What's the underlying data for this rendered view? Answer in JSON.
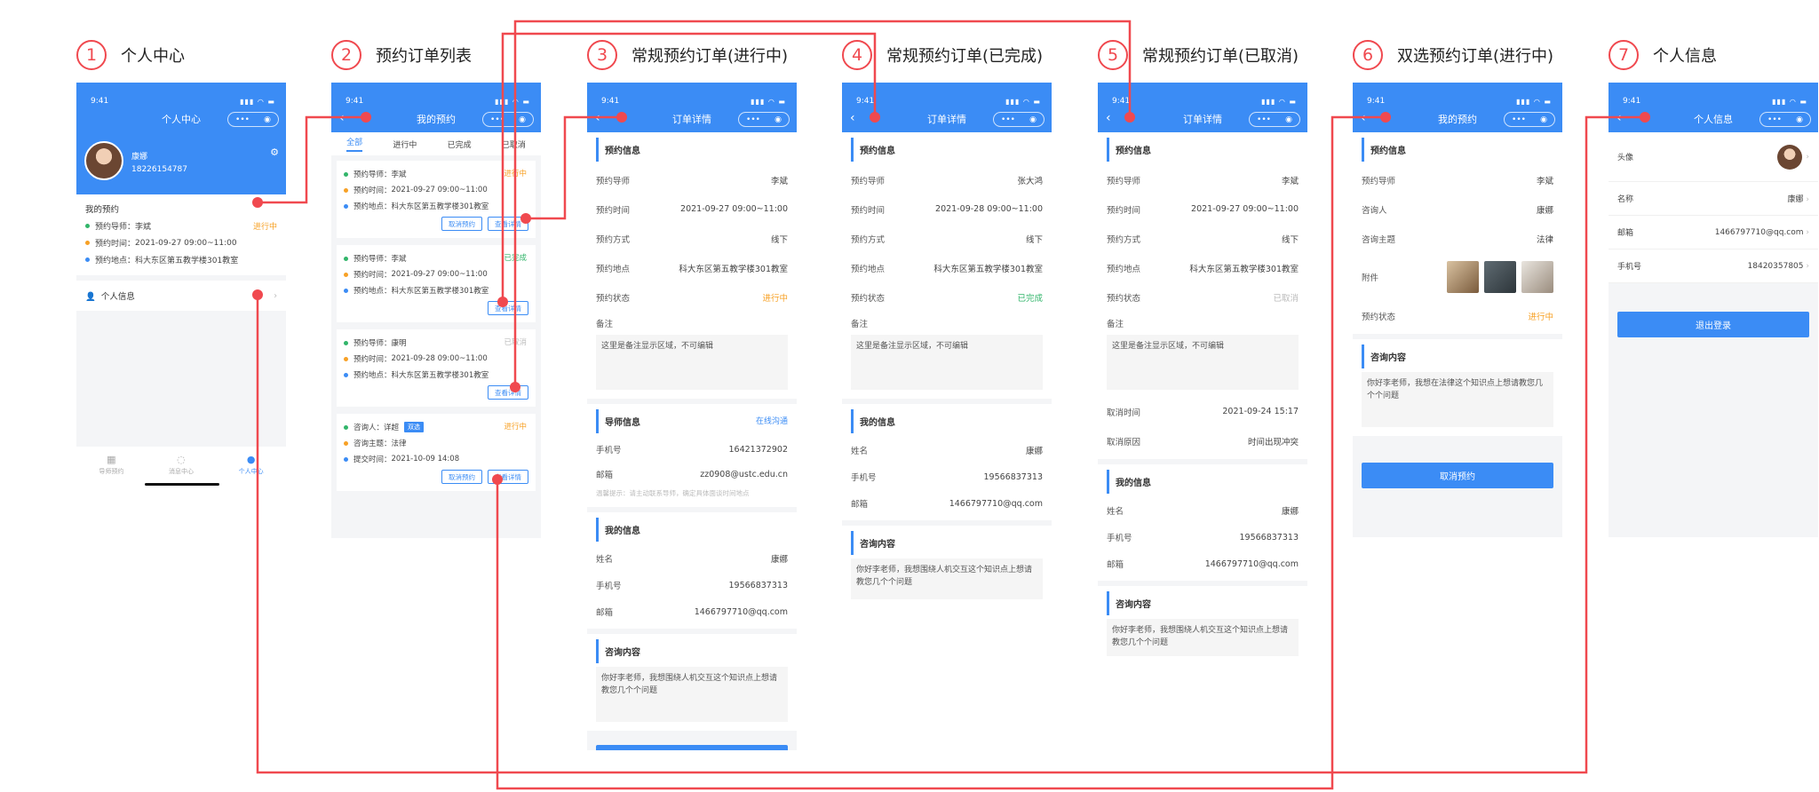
{
  "status_time": "9:41",
  "labels": {
    "mentor": "预约导师",
    "time": "预约时间",
    "method": "预约方式",
    "location": "预约地点",
    "state": "预约状态",
    "remark": "备注",
    "phone": "手机号",
    "email": "邮箱",
    "name": "姓名",
    "consultant": "咨询人",
    "topic": "咨询主题",
    "attachment": "附件",
    "cancel_time": "取消时间",
    "cancel_reason": "取消原因",
    "sec_appointment": "预约信息",
    "sec_mentor": "导师信息",
    "sec_my": "我的信息",
    "sec_content": "咨询内容",
    "online_chat": "在线沟通",
    "cancel_btn": "取消预约",
    "view_btn": "查看详情",
    "mentor_hint": "温馨提示：请主动联系导师，确定具体面谈时间地点",
    "pre_mentor": "预约导师：",
    "pre_time": "预约时间：",
    "pre_location": "预约地点：",
    "pre_consultant": "咨询人：",
    "pre_topic": "咨询主题：",
    "pre_submit": "提交时间："
  },
  "values": {
    "mentor_li": "李斌",
    "mentor_zhang": "张大鸿",
    "mentor_kang": "康明",
    "time_27": "2021-09-27 09:00~11:00",
    "time_28": "2021-09-28 09:00~11:00",
    "method": "线下",
    "location": "科大东区第五教学楼301教室",
    "status_ongoing": "进行中",
    "status_done": "已完成",
    "status_cancelled": "已取消",
    "remark_text": "这里是备注显示区域，不可编辑",
    "mentor_phone": "16421372902",
    "mentor_email": "zz0908@ustc.edu.cn",
    "my_name": "康娜",
    "my_phone": "19566837313",
    "my_email": "1466797710@qq.com",
    "consult_text": "你好李老师，我想围绕人机交互这个知识点上想请教您几个个问题",
    "consult_text_6": "你好李老师，我想在法律这个知识点上想请教您几个个问题",
    "cancel_time": "2021-09-24 15:17",
    "cancel_reason": "时间出现冲突",
    "consultant_name": "详超",
    "dual_badge": "双选",
    "topic_law": "法律",
    "submit_time": "2021-10-09 14:08"
  },
  "screens": [
    {
      "num": "1",
      "title": "个人中心",
      "nav_title": "个人中心",
      "user_name": "康娜",
      "user_phone": "18226154787",
      "my_appointment": "我的预约",
      "personal_info": "个人信息",
      "tabs": [
        "导师预约",
        "消息中心",
        "个人中心"
      ]
    },
    {
      "num": "2",
      "title": "预约订单列表",
      "nav_title": "我的预约",
      "tabs": [
        "全部",
        "进行中",
        "已完成",
        "已取消"
      ]
    },
    {
      "num": "3",
      "title": "常规预约订单(进行中)",
      "nav_title": "订单详情"
    },
    {
      "num": "4",
      "title": "常规预约订单(已完成)",
      "nav_title": "订单详情"
    },
    {
      "num": "5",
      "title": "常规预约订单(已取消)",
      "nav_title": "订单详情"
    },
    {
      "num": "6",
      "title": "双选预约订单(进行中)",
      "nav_title": "我的预约"
    },
    {
      "num": "7",
      "title": "个人信息",
      "nav_title": "个人信息",
      "avatar_label": "头像",
      "name_label": "名称",
      "name_value": "康娜",
      "email_label": "邮箱",
      "email_value": "1466797710@qq.com",
      "phone_label": "手机号",
      "phone_value": "18420357805",
      "logout": "退出登录"
    }
  ],
  "colors": {
    "brand": "#3b8cf5",
    "connector": "#f0494f",
    "ongoing": "#f7a126",
    "done": "#32b56a",
    "cancelled": "#bbbbbb"
  }
}
